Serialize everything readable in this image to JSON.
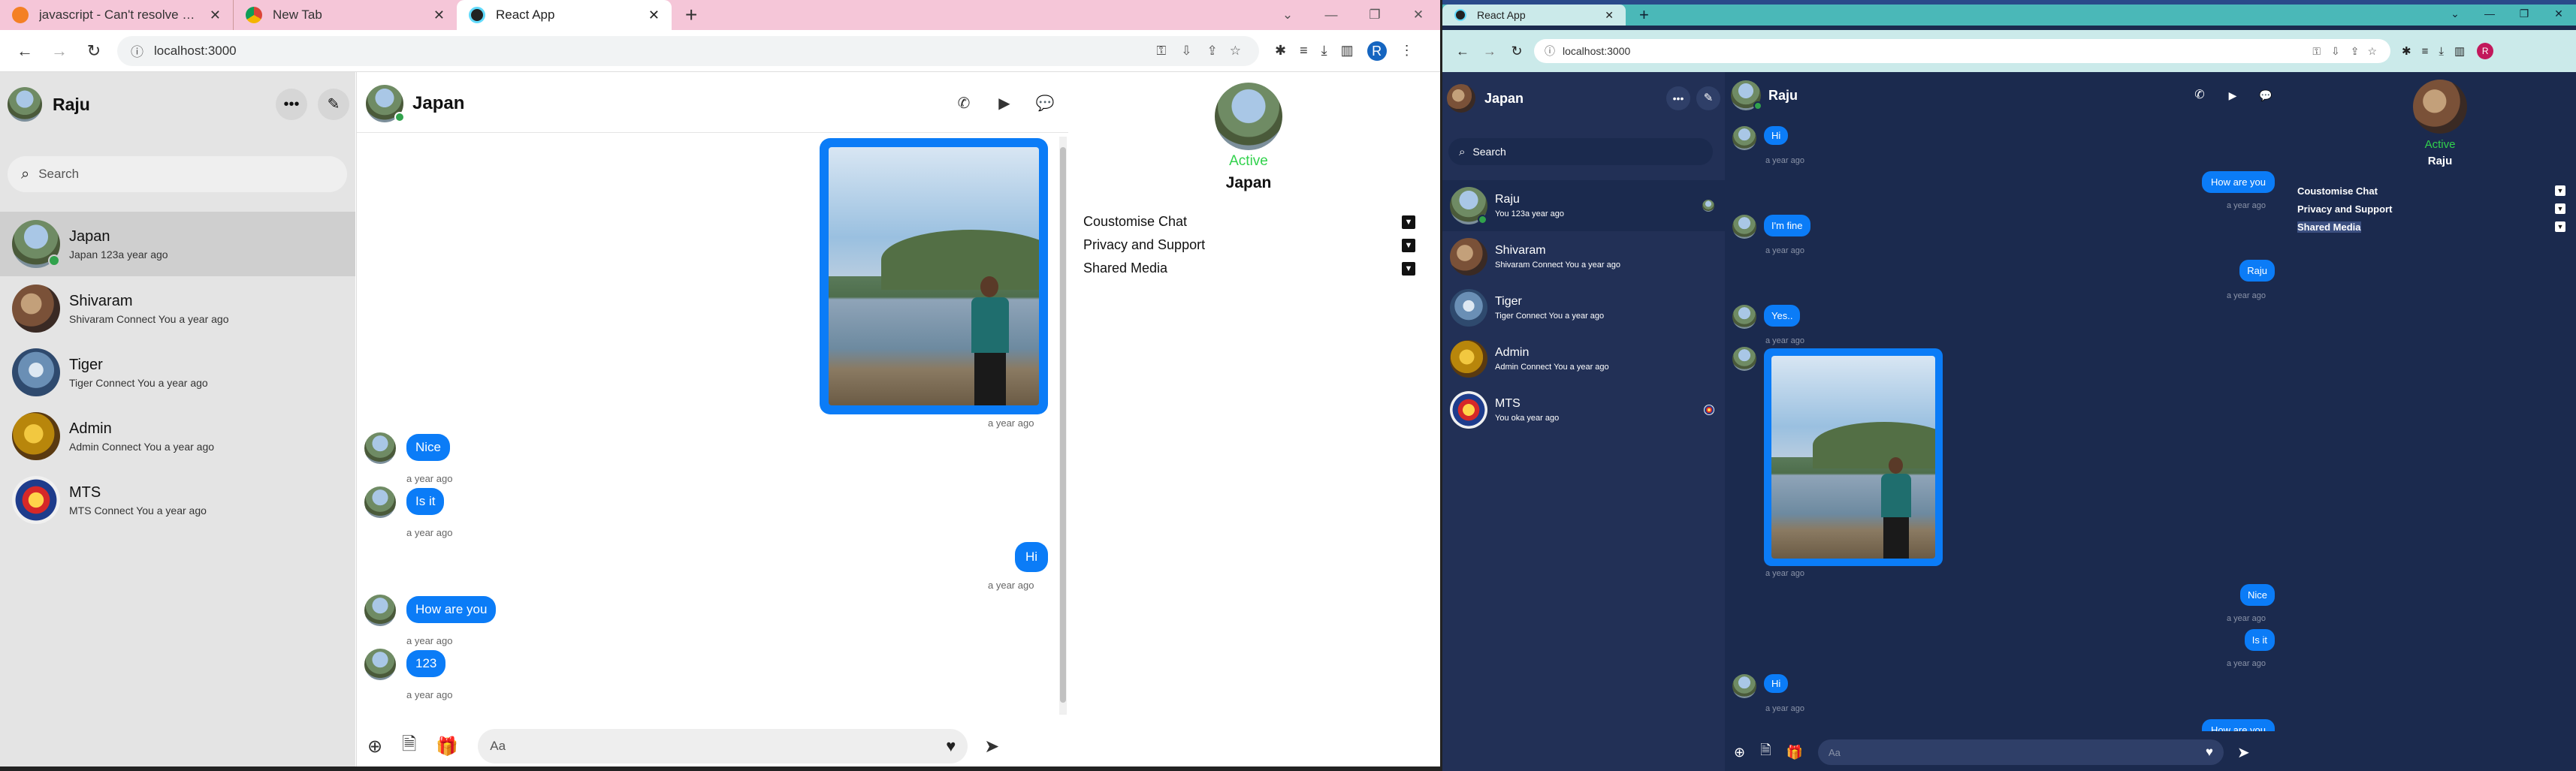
{
  "left": {
    "tabs": [
      {
        "title": "javascript - Can't resolve module",
        "icon": "stackoverflow-favicon-icon"
      },
      {
        "title": "New Tab",
        "icon": "chrome-favicon-icon"
      },
      {
        "title": "React App",
        "icon": "react-favicon-icon"
      }
    ],
    "url": "localhost:3000",
    "profile_letter": "R",
    "user_name": "Raju",
    "search_placeholder": "Search",
    "conversations": [
      {
        "name": "Japan",
        "preview": "Japan 123a year ago",
        "online": true
      },
      {
        "name": "Shivaram",
        "preview": "Shivaram Connect You a year ago"
      },
      {
        "name": "Tiger",
        "preview": "Tiger Connect You a year ago"
      },
      {
        "name": "Admin",
        "preview": "Admin Connect You a year ago"
      },
      {
        "name": "MTS",
        "preview": "MTS Connect You a year ago"
      }
    ],
    "chat_name": "Japan",
    "messages": [
      {
        "type": "image",
        "side": "right",
        "time": "a year ago"
      },
      {
        "type": "text",
        "side": "left",
        "text": "Nice",
        "time": "a year ago"
      },
      {
        "type": "text",
        "side": "left",
        "text": "Is it",
        "time": "a year ago"
      },
      {
        "type": "text",
        "side": "right",
        "text": "Hi",
        "time": "a year ago"
      },
      {
        "type": "text",
        "side": "left",
        "text": "How are you",
        "time": "a year ago"
      },
      {
        "type": "text",
        "side": "left",
        "text": "123",
        "time": "a year ago"
      }
    ],
    "composer_placeholder": "Aa",
    "profile": {
      "status": "Active",
      "name": "Japan"
    },
    "options": [
      "Coustomise Chat",
      "Privacy and Support",
      "Shared Media"
    ]
  },
  "right": {
    "tabs": [
      {
        "title": "React App",
        "icon": "react-favicon-icon"
      }
    ],
    "url": "localhost:3000",
    "profile_letter": "R",
    "user_name": "Japan",
    "search_placeholder": "Search",
    "conversations": [
      {
        "name": "Raju",
        "preview": "You 123a year ago",
        "online": true
      },
      {
        "name": "Shivaram",
        "preview": "Shivaram Connect You a year ago"
      },
      {
        "name": "Tiger",
        "preview": "Tiger Connect You a year ago"
      },
      {
        "name": "Admin",
        "preview": "Admin Connect You a year ago"
      },
      {
        "name": "MTS",
        "preview": "You oka year ago"
      }
    ],
    "chat_name": "Raju",
    "messages": [
      {
        "type": "text",
        "side": "left",
        "text": "Hi",
        "time": "a year ago"
      },
      {
        "type": "text",
        "side": "right",
        "text": "How are you",
        "time": "a year ago"
      },
      {
        "type": "text",
        "side": "left",
        "text": "I'm fine",
        "time": "a year ago"
      },
      {
        "type": "text",
        "side": "right",
        "text": "Raju",
        "time": "a year ago"
      },
      {
        "type": "text",
        "side": "left",
        "text": "Yes..",
        "time": "a year ago"
      },
      {
        "type": "image",
        "side": "left",
        "time": "a year ago"
      },
      {
        "type": "text",
        "side": "right",
        "text": "Nice",
        "time": "a year ago"
      },
      {
        "type": "text",
        "side": "right",
        "text": "Is it",
        "time": "a year ago"
      },
      {
        "type": "text",
        "side": "left",
        "text": "Hi",
        "time": "a year ago"
      },
      {
        "type": "text",
        "side": "right",
        "text": "How are you",
        "time": ""
      }
    ],
    "composer_placeholder": "Aa",
    "profile": {
      "status": "Active",
      "name": "Raju"
    },
    "options": [
      "Coustomise Chat",
      "Privacy and Support",
      "Shared Media"
    ]
  },
  "colors": {
    "accent": "#0b7cf7",
    "online": "#31a24c",
    "active_text": "#31d24c",
    "dark_bg": "#1b2a4e",
    "dark_panel": "#223056",
    "light_sidebar": "#e4e4e4"
  }
}
